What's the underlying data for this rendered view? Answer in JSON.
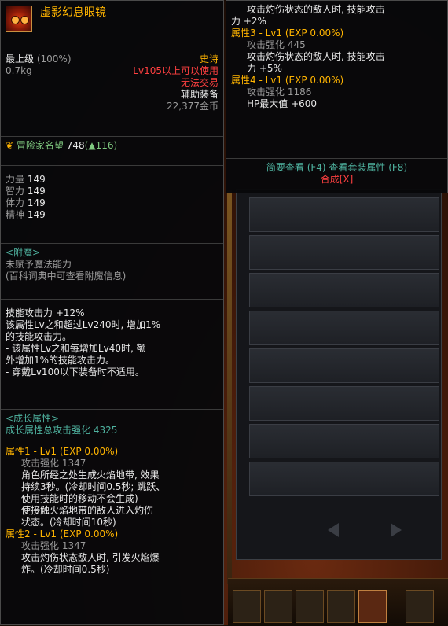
{
  "item": {
    "name": "虚影幻息眼镜",
    "grade": "最上级",
    "grade_pct": "(100%)",
    "weight": "0.7kg",
    "rarity": "史诗",
    "level_req": "Lv105以上可以使用",
    "trade": "无法交易",
    "type": "辅助装备",
    "price": "22,377金币"
  },
  "fame": {
    "label": "冒险家名望",
    "value": "748",
    "delta": "116"
  },
  "stats": [
    {
      "label": "力量",
      "value": "149"
    },
    {
      "label": "智力",
      "value": "149"
    },
    {
      "label": "体力",
      "value": "149"
    },
    {
      "label": "精神",
      "value": "149"
    }
  ],
  "enchant": {
    "title": "<附魔>",
    "line1": "未赋予魔法能力",
    "line2": "(百科词典中可查看附魔信息)"
  },
  "skill": {
    "l1": "技能攻击力 +12%",
    "l2": "该属性Lv之和超过Lv240时, 增加1%",
    "l3": "的技能攻击力。",
    "l4": "- 该属性Lv之和每增加Lv40时, 额",
    "l5": "外增加1%的技能攻击力。",
    "l6": "- 穿戴Lv100以下装备时不适用。"
  },
  "growth": {
    "title": "<成长属性>",
    "total": "成长属性总攻击强化 4325",
    "attr1": {
      "head": "属性1 - Lv1 (EXP 0.00%)",
      "boost": "攻击强化 1347",
      "d1": "角色所经之处生成火焰地带, 效果",
      "d2": "持续3秒。(冷却时间0.5秒; 跳跃、",
      "d3": "使用技能时的移动不会生成)",
      "d4": "使接触火焰地带的敌人进入灼伤",
      "d5": "状态。(冷却时间10秒)"
    },
    "attr2": {
      "head": "属性2 - Lv1 (EXP 0.00%)",
      "boost": "攻击强化 1347",
      "d1": "攻击灼伤状态敌人时, 引发火焰爆",
      "d2": "炸。(冷却时间0.5秒)"
    }
  },
  "popup": {
    "p1": "攻击灼伤状态的敌人时, 技能攻击",
    "p2": "力 +2%",
    "attr3_head": "属性3 - Lv1 (EXP 0.00%)",
    "attr3_boost": "攻击强化 445",
    "attr3_d1": "攻击灼伤状态的敌人时, 技能攻击",
    "attr3_d2": "力 +5%",
    "attr4_head": "属性4 - Lv1 (EXP 0.00%)",
    "attr4_boost": "攻击强化 1186",
    "attr4_hp": "HP最大值 +600",
    "foot1": "简要查看 (F4) 查看套装属性 (F8)",
    "foot2": "合成[X]"
  },
  "colors": {
    "rarity": "#ffb400",
    "req_red": "#ff4040",
    "growth": "#ffb400",
    "fame": "#7fc97f"
  }
}
